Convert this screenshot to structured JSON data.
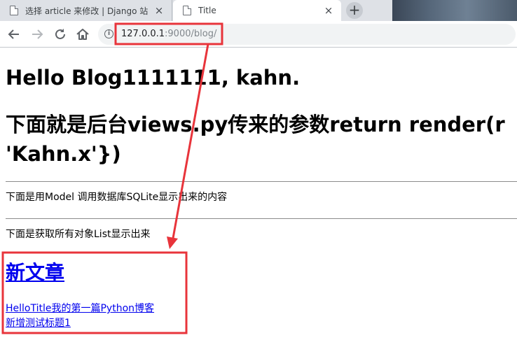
{
  "browser": {
    "tabs": [
      {
        "title": "选择 article 来修改 | Django 站",
        "close": "×"
      },
      {
        "title": "Title",
        "close": "×"
      }
    ],
    "new_tab": "+",
    "address": {
      "host": "127.0.0.1",
      "rest": ":9000/blog/"
    },
    "info_glyph": "i"
  },
  "page": {
    "hello_heading": "Hello Blog1111111, kahn.",
    "params_heading_line1": "下面就是后台views.py传来的参数return render(r",
    "params_heading_line2": "'Kahn.x'})",
    "model_text": "下面是用Model 调用数据库SQLite显示出来的内容",
    "list_text": "下面是获取所有对象List显示出来",
    "article_title": "新文章",
    "links": [
      "HelloTitle我的第一篇Python博客",
      "新增测试标题1"
    ]
  },
  "annotation": {
    "color": "#e8343b"
  }
}
